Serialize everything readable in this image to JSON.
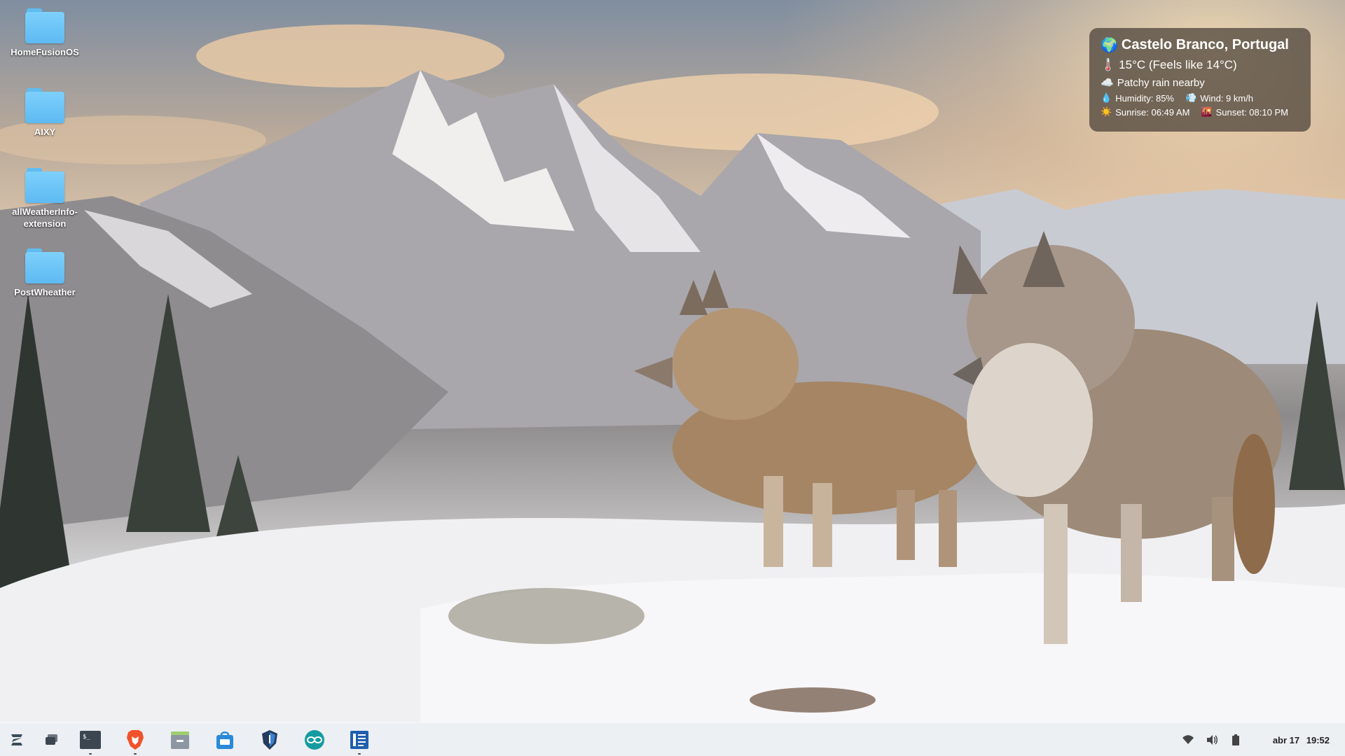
{
  "desktop": {
    "icons": [
      {
        "label": "HomeFusionOS",
        "icon": "folder-icon"
      },
      {
        "label": "AIXY",
        "icon": "folder-icon"
      },
      {
        "label": "allWeatherInfo-extension",
        "icon": "folder-icon"
      },
      {
        "label": "PostWheather",
        "icon": "folder-icon"
      }
    ],
    "wallpaper": "wolves-snowy-mountains"
  },
  "weather": {
    "location": "Castelo Branco, Portugal",
    "temperature": "15°C (Feels like 14°C)",
    "condition": "Patchy rain nearby",
    "humidity": "Humidity: 85%",
    "wind": "Wind: 9 km/h",
    "sunrise": "Sunrise: 06:49 AM",
    "sunset": "Sunset: 08:10 PM",
    "icons": {
      "location": "globe-icon",
      "temperature": "thermometer-icon",
      "condition": "cloud-icon",
      "humidity": "droplet-icon",
      "wind": "wind-icon",
      "sunrise": "sun-icon",
      "sunset": "sunset-icon"
    }
  },
  "taskbar": {
    "apps": [
      {
        "name": "zorin-menu",
        "icon": "zorin-logo-icon",
        "running": false
      },
      {
        "name": "workspaces",
        "icon": "workspaces-icon",
        "running": false
      },
      {
        "name": "terminal",
        "icon": "terminal-icon",
        "running": true
      },
      {
        "name": "brave-browser",
        "icon": "brave-lion-icon",
        "running": true
      },
      {
        "name": "files",
        "icon": "file-manager-icon",
        "running": false
      },
      {
        "name": "software-store",
        "icon": "store-bag-icon",
        "running": false
      },
      {
        "name": "security",
        "icon": "shield-icon",
        "running": false
      },
      {
        "name": "arduino",
        "icon": "arduino-icon",
        "running": false
      },
      {
        "name": "document-editor",
        "icon": "document-icon",
        "running": true
      }
    ],
    "tray": {
      "wifi": "wifi-icon",
      "volume": "volume-icon",
      "battery": "battery-icon"
    },
    "clock": {
      "date": "abr 17",
      "time": "19:52"
    }
  },
  "colors": {
    "folder": "#6cc6f7",
    "widget_bg": "#463e36",
    "taskbar_bg": "#eceff2"
  }
}
